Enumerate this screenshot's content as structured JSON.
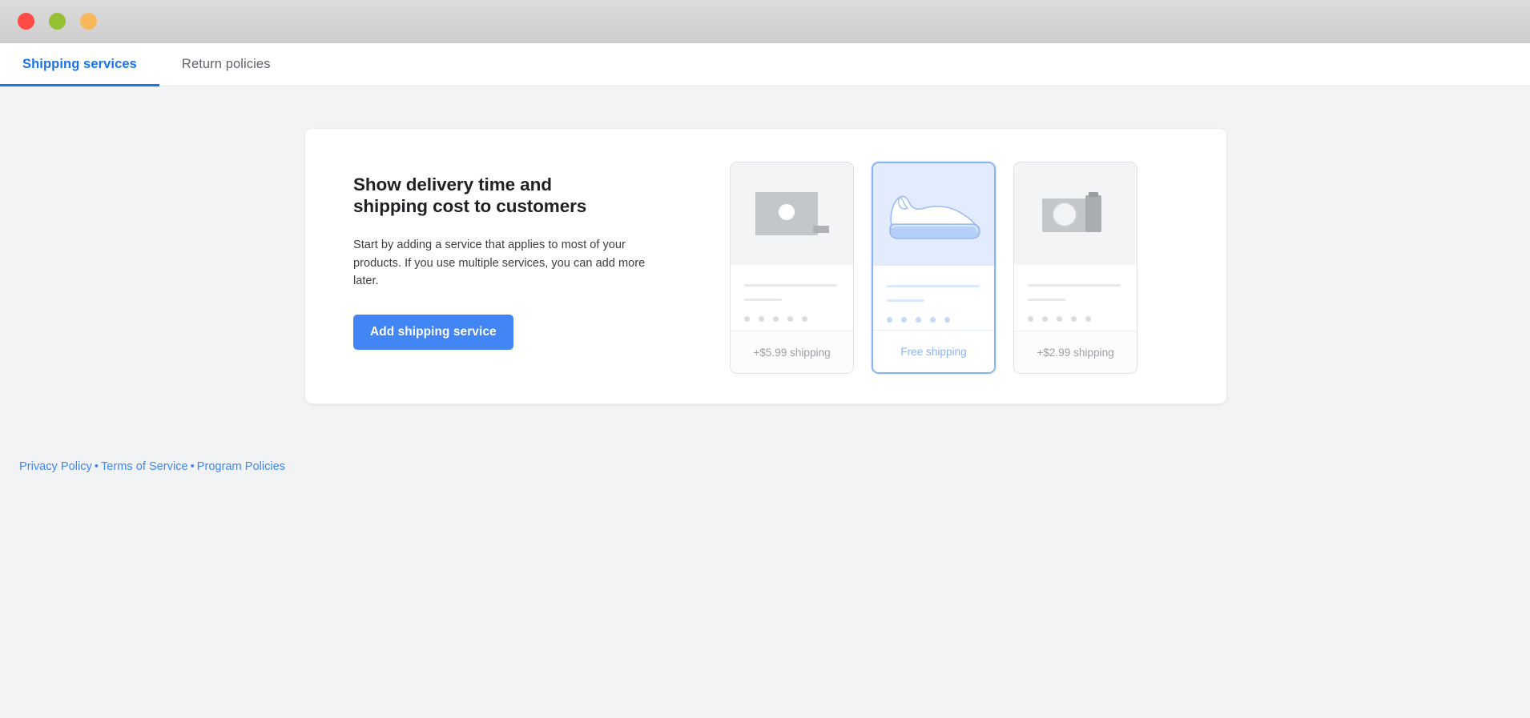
{
  "window": {
    "controls": [
      {
        "name": "close",
        "color": "#ff4b45"
      },
      {
        "name": "minimize",
        "color": "#93c132"
      },
      {
        "name": "maximize",
        "color": "#f7b85c"
      }
    ]
  },
  "tabs": [
    {
      "label": "Shipping services",
      "active": true
    },
    {
      "label": "Return policies",
      "active": false
    }
  ],
  "panel": {
    "title": "Show delivery time and shipping cost to customers",
    "description": "Start by adding a service that applies to most of your products. If you use multiple services, you can add more later.",
    "cta_label": "Add shipping service"
  },
  "product_cards": [
    {
      "id": "card-1",
      "icon": "image-placeholder-icon",
      "shipping_label": "+$5.99 shipping",
      "selected": false
    },
    {
      "id": "card-2",
      "icon": "shoe-icon",
      "shipping_label": "Free shipping",
      "selected": true
    },
    {
      "id": "card-3",
      "icon": "camera-icon",
      "shipping_label": "+$2.99 shipping",
      "selected": false
    }
  ],
  "footer": {
    "links": [
      {
        "label": "Privacy Policy"
      },
      {
        "label": "Terms of Service"
      },
      {
        "label": "Program Policies"
      }
    ],
    "separator": "•"
  },
  "colors": {
    "accent_blue": "#4285f4",
    "tab_active": "#1a73e8",
    "selected_card_border": "#8ab4f8",
    "page_bg": "#f1f3f4",
    "text_primary": "#202124",
    "text_secondary": "#5f6368",
    "muted": "#9aa0a6"
  }
}
